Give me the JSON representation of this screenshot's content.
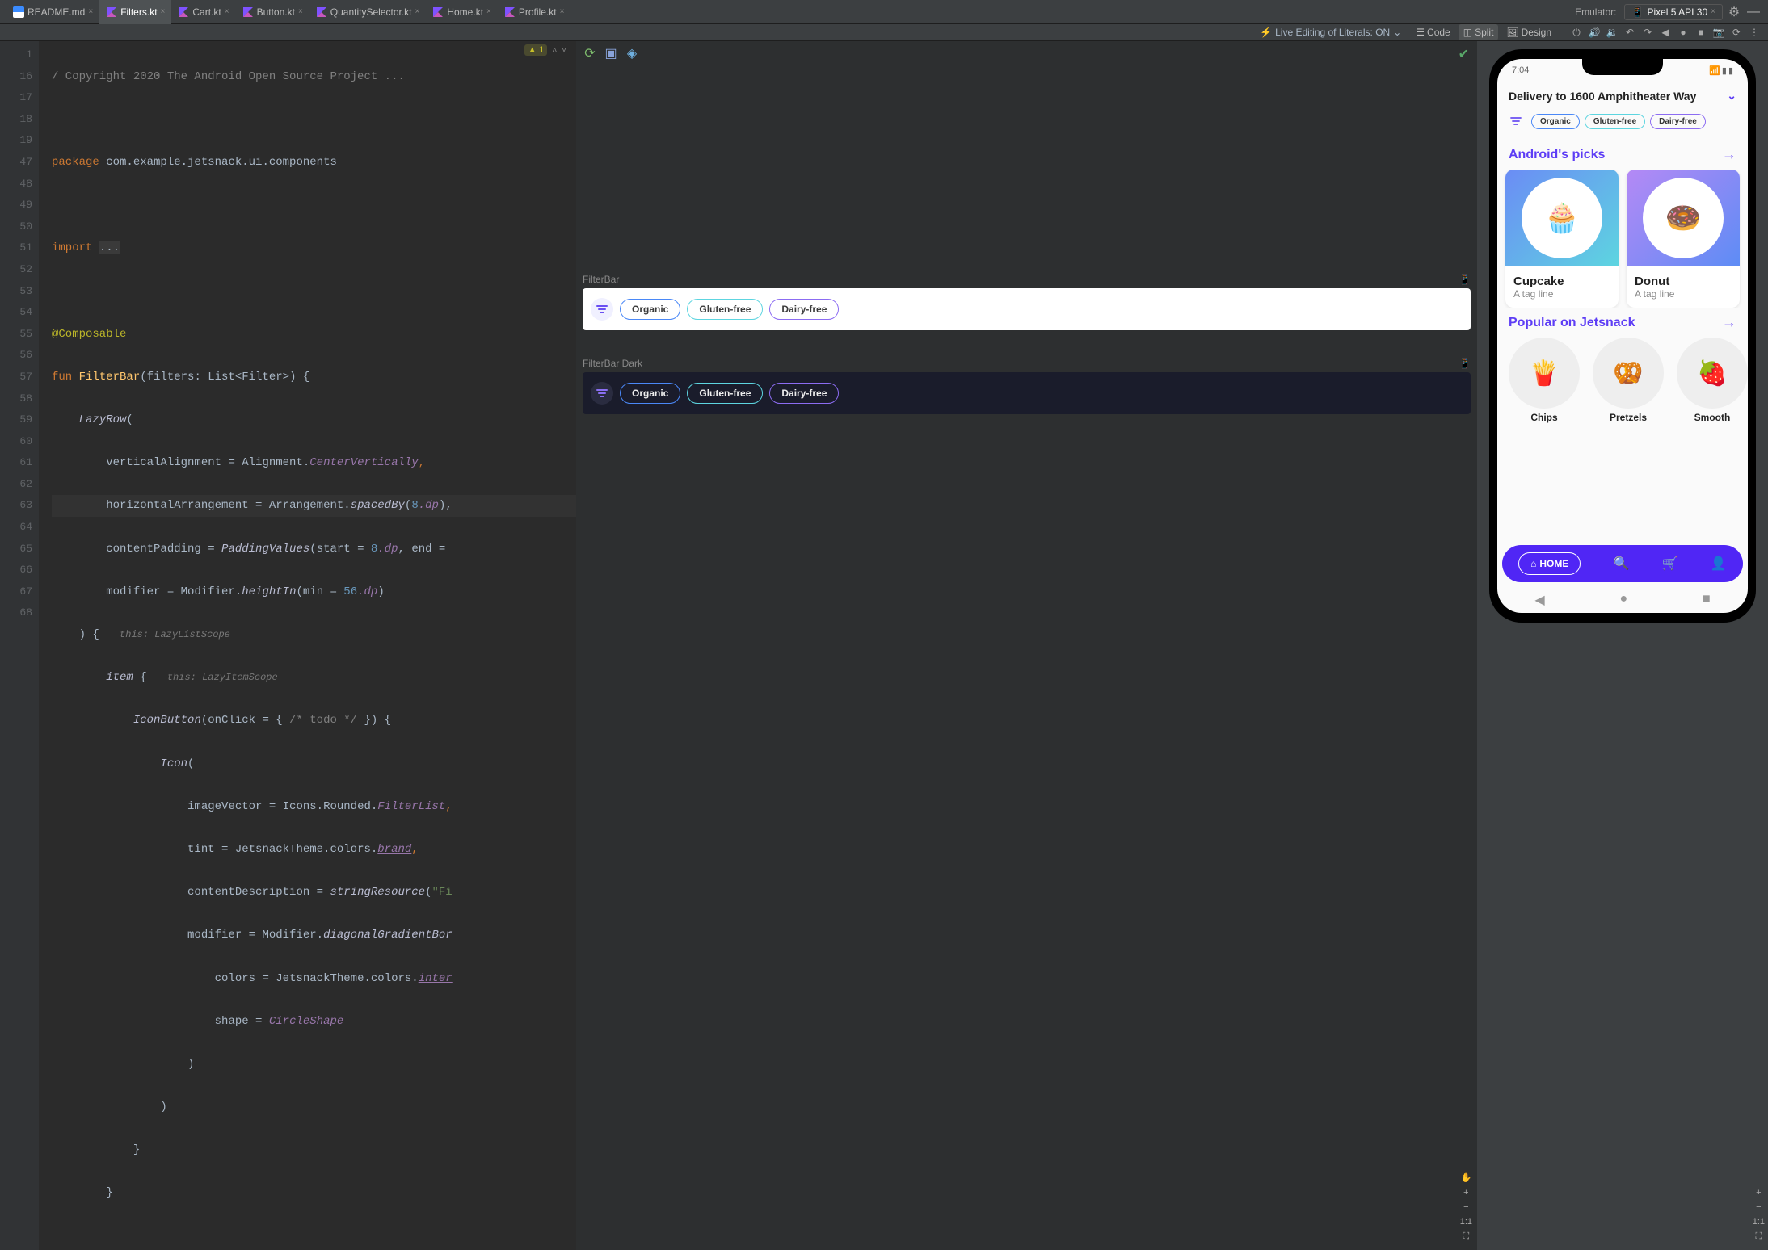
{
  "tabs": [
    {
      "name": "README.md",
      "type": "md"
    },
    {
      "name": "Filters.kt",
      "type": "kt",
      "active": true
    },
    {
      "name": "Cart.kt",
      "type": "kt"
    },
    {
      "name": "Button.kt",
      "type": "kt"
    },
    {
      "name": "QuantitySelector.kt",
      "type": "kt"
    },
    {
      "name": "Home.kt",
      "type": "kt"
    },
    {
      "name": "Profile.kt",
      "type": "kt"
    }
  ],
  "emulator_label": "Emulator:",
  "emulator_selected": "Pixel 5 API 30",
  "mode_bar": {
    "live_edit": "Live Editing of Literals: ON",
    "code": "Code",
    "split": "Split",
    "design": "Design"
  },
  "editor": {
    "line_numbers": [
      "1",
      "16",
      "17",
      "18",
      "19",
      "47",
      "48",
      "49",
      "50",
      "51",
      "52",
      "53",
      "54",
      "55",
      "56",
      "57",
      "58",
      "59",
      "60",
      "61",
      "62",
      "63",
      "64",
      "65",
      "66",
      "67",
      "68"
    ],
    "warn_count": "1",
    "comment_line": "/ Copyright 2020 The Android Open Source Project ...",
    "package_kw": "package ",
    "package_name": "com.example.jetsnack.ui.components",
    "import_kw": "import ",
    "import_rest": "...",
    "anno": "@Composable",
    "fun_kw": "fun ",
    "fun_name": "FilterBar",
    "fun_sig": "(filters: List<Filter>) {",
    "lazyrow": "LazyRow",
    "lazyrow_paren": "(",
    "va_param": "verticalAlignment = ",
    "va_val": "Alignment.",
    "va_val2": "CenterVertically",
    "va_comma": ",",
    "ha_param": "horizontalArrangement = ",
    "ha_val": "Arrangement.",
    "ha_m": "spacedBy",
    "ha_arg": "(",
    "ha_num": "8",
    "ha_dp": ".dp",
    "ha_end": "),",
    "cp_param": "contentPadding = ",
    "cp_call": "PaddingValues",
    "cp_arg": "(start = ",
    "cp_num1": "8",
    "cp_dp1": ".dp",
    "cp_mid": ", end = ",
    "mod_param": "modifier = ",
    "mod_val": "Modifier.",
    "mod_m": "heightIn",
    "mod_arg": "(min = ",
    "mod_num": "56",
    "mod_dp": ".dp",
    "mod_end": ")",
    "brace1": ") {",
    "hint1": "this: LazyListScope",
    "item_kw": "item",
    "item_brace": " {",
    "hint2": "this: LazyItemScope",
    "icbtn": "IconButton",
    "icbtn_arg": "(onClick = { ",
    "icbtn_todo": "/* todo */",
    "icbtn_end": " }) {",
    "icon_call": "Icon",
    "icon_paren": "(",
    "iv_param": "imageVector = ",
    "iv_val": "Icons.Rounded.",
    "iv_fl": "FilterList",
    "iv_end": ",",
    "tint_param": "tint = ",
    "tint_val": "JetsnackTheme.colors.",
    "tint_brand": "brand",
    "tint_end": ",",
    "cd_param": "contentDescription = ",
    "cd_call": "stringResource",
    "cd_arg": "(",
    "cd_str": "\"Fi",
    "modi_param": "modifier = ",
    "modi_val": "Modifier.",
    "modi_m": "diagonalGradientBor",
    "colors_param": "colors = ",
    "colors_val": "JetsnackTheme.colors.",
    "colors_inter": "inter",
    "shape_param": "shape = ",
    "shape_val": "CircleShape",
    "close_paren1": ")",
    "close_paren2": ")",
    "close_brace1": "}",
    "close_brace2": "}"
  },
  "preview": {
    "light_label": "FilterBar",
    "dark_label": "FilterBar Dark",
    "chips": [
      "Organic",
      "Gluten-free",
      "Dairy-free"
    ],
    "zoom_1to1": "1:1"
  },
  "app": {
    "time": "7:04",
    "delivery": "Delivery to 1600 Amphitheater Way",
    "chips": [
      "Organic",
      "Gluten-free",
      "Dairy-free"
    ],
    "section1": "Android's picks",
    "card1_title": "Cupcake",
    "card1_sub": "A tag line",
    "card2_title": "Donut",
    "card2_sub": "A tag line",
    "section2": "Popular on Jetsnack",
    "pop1": "Chips",
    "pop2": "Pretzels",
    "pop3": "Smooth",
    "home_label": "HOME",
    "zoom_1to1": "1:1"
  }
}
